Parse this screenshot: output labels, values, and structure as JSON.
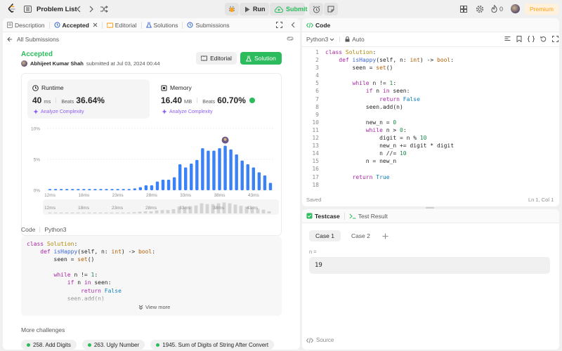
{
  "topbar": {
    "problem_list": "Problem List",
    "run": "Run",
    "submit": "Submit",
    "streak": "0",
    "premium": "Premium"
  },
  "left": {
    "tabs": [
      {
        "label": "Description"
      },
      {
        "label": "Accepted"
      },
      {
        "label": "Editorial"
      },
      {
        "label": "Solutions"
      },
      {
        "label": "Submissions"
      }
    ],
    "back_label": "All Submissions",
    "status": "Accepted",
    "user": "Abhijeet Kumar Shah",
    "submitted_text": "submitted at Jul 03, 2024 00:44",
    "editorial_btn": "Editorial",
    "solution_btn": "Solution",
    "runtime": {
      "label": "Runtime",
      "value": "40",
      "unit": "ms",
      "beats_label": "Beats",
      "beats": "36.64%",
      "analyze": "Analyze Complexity"
    },
    "memory": {
      "label": "Memory",
      "value": "16.40",
      "unit": "MB",
      "beats_label": "Beats",
      "beats": "60.70%",
      "analyze": "Analyze Complexity"
    },
    "code_label": "Code",
    "code_lang": "Python3",
    "view_more": "View more",
    "more_challenges": "More challenges",
    "challenges": [
      "258. Add Digits",
      "263. Ugly Number",
      "1945. Sum of Digits of String After Convert"
    ]
  },
  "chart_data": {
    "type": "bar",
    "yticks": [
      "10%",
      "5%",
      "0%"
    ],
    "ylim": [
      0,
      10
    ],
    "xticks": [
      "12ms",
      "18ms",
      "23ms",
      "28ms",
      "33ms",
      "38ms",
      "43ms"
    ],
    "values": [
      0.2,
      0.2,
      0.2,
      0.2,
      0.2,
      0.2,
      0.2,
      0.2,
      0.2,
      0.2,
      0.2,
      0.2,
      0.2,
      0.2,
      0.2,
      0.3,
      0.5,
      0.8,
      0.8,
      1.4,
      1.7,
      1.7,
      2.1,
      4.2,
      3.7,
      4.3,
      4.9,
      6.8,
      6.4,
      6.4,
      6.8,
      7.2,
      6.6,
      5.8,
      4.8,
      4.2,
      3.7,
      2.9,
      2.4,
      1.2
    ],
    "highlight_index": 31,
    "mini_values": [
      0.2,
      0.2,
      0.2,
      0.2,
      0.2,
      0.2,
      0.2,
      0.2,
      0.2,
      0.2,
      0.2,
      0.2,
      0.2,
      0.2,
      0.2,
      0.3,
      0.4,
      0.5,
      0.5,
      0.7,
      0.8,
      0.8,
      1.0,
      1.6,
      1.4,
      1.7,
      1.9,
      2.4,
      2.2,
      2.2,
      2.4,
      2.6,
      2.4,
      2.1,
      1.8,
      1.6,
      1.4,
      1.1,
      0.9,
      0.5
    ]
  },
  "right": {
    "code_tab": "Code",
    "lang": "Python3",
    "auto": "Auto",
    "saved": "Saved",
    "cursor": "Ln 1, Col 1",
    "testcase_tab": "Testcase",
    "result_tab": "Test Result",
    "cases": [
      "Case 1",
      "Case 2"
    ],
    "input_label": "n =",
    "input_value": "19",
    "source": "Source"
  }
}
